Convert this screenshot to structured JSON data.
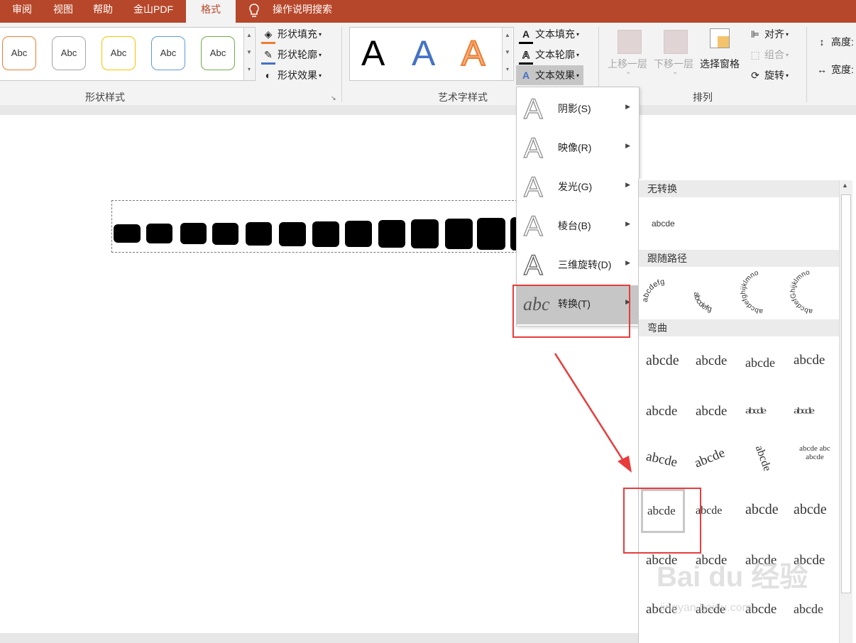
{
  "tabs": [
    "审阅",
    "视图",
    "帮助",
    "金山PDF",
    "格式"
  ],
  "tell_me": "操作说明搜索",
  "shape_styles": {
    "thumbs": [
      {
        "label": "Abc",
        "color": "#ed7d31"
      },
      {
        "label": "Abc",
        "color": "#a5a5a5"
      },
      {
        "label": "Abc",
        "color": "#ffc000"
      },
      {
        "label": "Abc",
        "color": "#5b9bd5"
      },
      {
        "label": "Abc",
        "color": "#70ad47"
      }
    ],
    "fill": "形状填充",
    "outline": "形状轮廓",
    "effects": "形状效果",
    "group_label": "形状样式"
  },
  "wordart": {
    "letters": [
      {
        "label": "A",
        "color": "#000000"
      },
      {
        "label": "A",
        "color": "#4472c4"
      },
      {
        "label": "A",
        "color": "#ed7d31"
      }
    ],
    "text_fill": "文本填充",
    "text_outline": "文本轮廓",
    "text_effects": "文本效果",
    "group_label": "艺术字样式"
  },
  "arrange": {
    "bring_forward": "上移一层",
    "send_backward": "下移一层",
    "selection_pane": "选择窗格",
    "align": "对齐",
    "group": "组合",
    "rotate": "旋转",
    "group_label": "排列"
  },
  "size": {
    "height": "高度:",
    "width": "宽度:"
  },
  "effects_menu": [
    {
      "label": "阴影(S)"
    },
    {
      "label": "映像(R)"
    },
    {
      "label": "发光(G)"
    },
    {
      "label": "棱台(B)"
    },
    {
      "label": "三维旋转(D)"
    },
    {
      "label": "转换(T)"
    }
  ],
  "transform": {
    "no_transform_header": "无转换",
    "no_transform_sample": "abcde",
    "follow_path_header": "跟随路径",
    "follow_path": [
      "abcdefg",
      "abcdefg",
      "abcdefghijklmno",
      "abcdefGhijklmno"
    ],
    "warp_header": "弯曲",
    "warp_rows": [
      [
        "abcde",
        "abcde",
        "abcde",
        "abcde"
      ],
      [
        "abcde",
        "abcde",
        "abcde",
        "abcde"
      ],
      [
        "abcde",
        "abcde",
        "abcde",
        "abcde abc abcde"
      ],
      [
        "abcde",
        "abcde",
        "abcde",
        "abcde"
      ],
      [
        "abcde",
        "abcde",
        "abcde",
        "abcde"
      ],
      [
        "abcde",
        "abcde",
        "abcde",
        "abcde"
      ]
    ]
  },
  "watermark": "Bai du 经验",
  "watermark_url": "jingyan.baidu.com"
}
